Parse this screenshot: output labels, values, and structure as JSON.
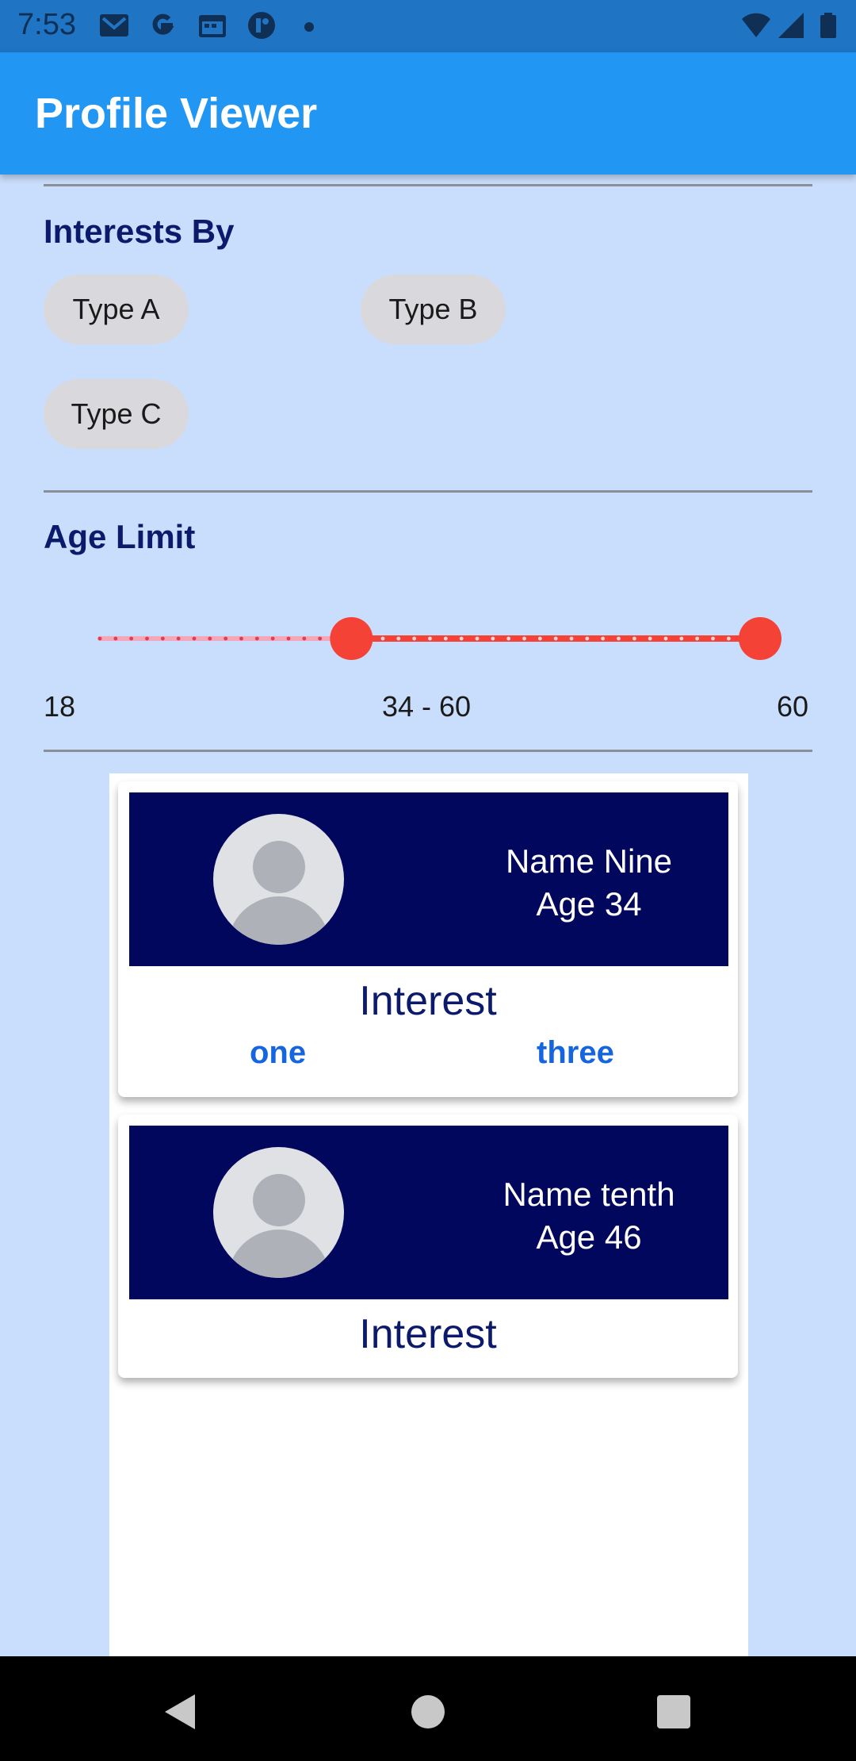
{
  "status_bar": {
    "time": "7:53",
    "left_icons": [
      "gmail-icon",
      "google-icon",
      "calendar-icon",
      "app-icon"
    ],
    "right_icons": [
      "wifi-icon",
      "signal-icon",
      "battery-icon"
    ]
  },
  "app_bar": {
    "title": "Profile Viewer"
  },
  "interests": {
    "title": "Interests By",
    "chips": [
      "Type A",
      "Type B",
      "Type C"
    ]
  },
  "age": {
    "title": "Age Limit",
    "min_label": "18",
    "range_label": "34 - 60",
    "max_label": "60",
    "min": 18,
    "max": 60,
    "selected_low": 34,
    "selected_high": 60,
    "active_color": "#f44336",
    "inactive_color": "#f4a7b9"
  },
  "profiles": [
    {
      "name": "Name Nine",
      "age": "Age 34",
      "interest_label": "Interest",
      "interests": [
        "one",
        "three"
      ]
    },
    {
      "name": "Name tenth",
      "age": "Age 46",
      "interest_label": "Interest",
      "interests": []
    }
  ],
  "nav_bar": {
    "buttons": [
      "back-icon",
      "home-icon",
      "recents-icon"
    ]
  },
  "colors": {
    "app_bar": "#2196f3",
    "status_bar": "#1f74c4",
    "background": "#c9defc",
    "card_banner": "#02075e",
    "interest_tag": "#1565e0"
  }
}
